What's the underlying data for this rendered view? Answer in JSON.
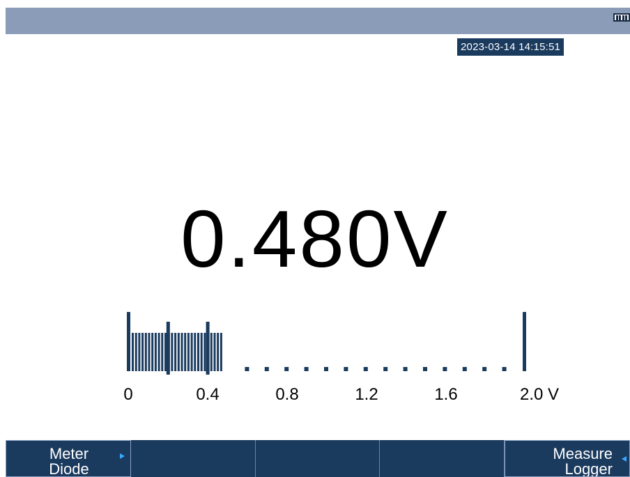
{
  "status_bar": {
    "battery_icon": "battery-icon"
  },
  "clock": {
    "datetime": "2023-03-14 14:15:51"
  },
  "meter": {
    "reading": "0.480V",
    "value": 0.48,
    "unit": "V"
  },
  "bargraph": {
    "min": 0,
    "max": 2.0,
    "filled_to": 0.48,
    "tick_labels": [
      "0",
      "0.4",
      "0.8",
      "1.2",
      "1.6",
      "2.0  V"
    ],
    "color": "#1a3a5e"
  },
  "softkeys": [
    {
      "lines": [
        "Meter",
        "Diode"
      ],
      "active": true,
      "arrow": "right"
    },
    {
      "lines": [],
      "active": false
    },
    {
      "lines": [],
      "active": false
    },
    {
      "lines": [],
      "active": false
    },
    {
      "lines": [
        "Measure",
        "Logger"
      ],
      "active": true,
      "arrow": "left"
    }
  ],
  "colors": {
    "topbar": "#8a9cb8",
    "accent": "#1a3a5e",
    "arrow": "#38a8ff"
  }
}
